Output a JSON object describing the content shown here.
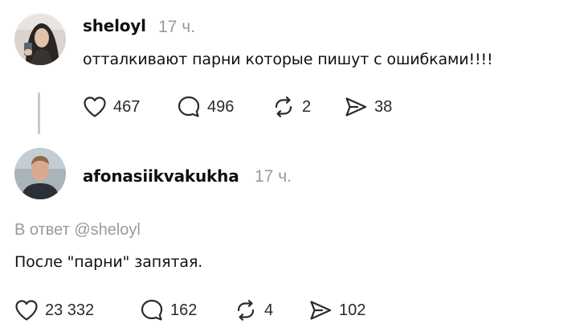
{
  "post": {
    "username": "sheloyl",
    "time": "17 ч.",
    "text": "отталкивают парни которые пишут с ошибками!!!!",
    "actions": {
      "likes": "467",
      "comments": "496",
      "reposts": "2",
      "shares": "38"
    }
  },
  "reply": {
    "username": "afonasiikvakukha",
    "time": "17 ч.",
    "reply_to": "В ответ @sheloyl",
    "text": "После \"парни\" запятая.",
    "actions": {
      "likes": "23 332",
      "comments": "162",
      "reposts": "4",
      "shares": "102"
    }
  },
  "icons": {
    "like": "heart-icon",
    "comment": "comment-bubble-icon",
    "repost": "repost-icon",
    "share": "send-icon"
  }
}
